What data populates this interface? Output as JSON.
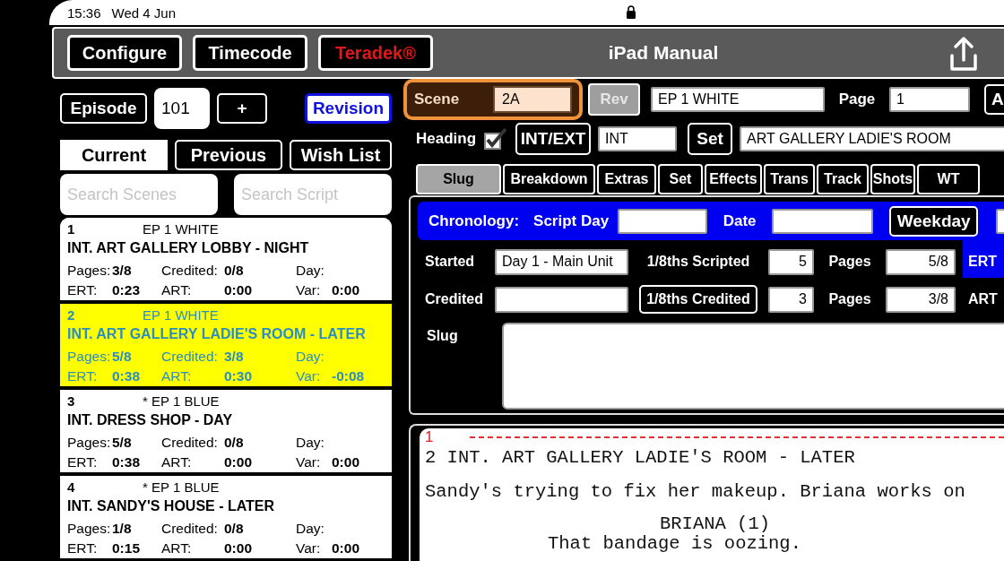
{
  "status_bar": {
    "time": "15:36",
    "date": "Wed 4 Jun"
  },
  "toolbar": {
    "buttons": [
      {
        "label": "Configure",
        "kind": "plain"
      },
      {
        "label": "Timecode",
        "kind": "plain"
      },
      {
        "label": "Teradek®",
        "kind": "alert"
      }
    ],
    "title": "iPad Manual"
  },
  "episode": {
    "button": "Episode",
    "value": "101",
    "add": "+",
    "revision": "Revision"
  },
  "list_tabs": [
    {
      "label": "Current",
      "selected": true
    },
    {
      "label": "Previous",
      "selected": false
    },
    {
      "label": "Wish List",
      "selected": false
    }
  ],
  "search": [
    {
      "placeholder": "Search Scenes"
    },
    {
      "placeholder": "Search Script"
    }
  ],
  "scenes": [
    {
      "number": "1",
      "revision": "EP 1 WHITE",
      "heading": "INT. ART GALLERY LOBBY - NIGHT",
      "selected": false,
      "fields": [
        {
          "label": "Pages:",
          "value": "3/8"
        },
        {
          "label": "Credited:",
          "value": "0/8"
        },
        {
          "label": "Day:"
        },
        {
          "label": "ERT:",
          "value": "0:23"
        },
        {
          "label": "ART:",
          "value": "0:00"
        },
        {
          "label": "Var:",
          "value": "0:00"
        }
      ]
    },
    {
      "number": "2",
      "revision": "EP 1 WHITE",
      "heading": "INT. ART GALLERY LADIE'S ROOM - LATER",
      "selected": true,
      "fields": [
        {
          "label": "Pages:",
          "value": "5/8"
        },
        {
          "label": "Credited:",
          "value": "3/8"
        },
        {
          "label": "Day:"
        },
        {
          "label": "ERT:",
          "value": "0:38"
        },
        {
          "label": "ART:",
          "value": "0:30"
        },
        {
          "label": "Var:",
          "value": "-0:08"
        }
      ]
    },
    {
      "number": "3",
      "revision": "* EP 1 BLUE",
      "heading": "INT. DRESS SHOP - DAY",
      "selected": false,
      "fields": [
        {
          "label": "Pages:",
          "value": "5/8"
        },
        {
          "label": "Credited:",
          "value": "0/8"
        },
        {
          "label": "Day:"
        },
        {
          "label": "ERT:",
          "value": "0:38"
        },
        {
          "label": "ART:",
          "value": "0:00"
        },
        {
          "label": "Var:",
          "value": "0:00"
        }
      ]
    },
    {
      "number": "4",
      "revision": "* EP 1 BLUE",
      "heading": "INT. SANDY'S HOUSE - LATER",
      "selected": false,
      "fields": [
        {
          "label": "Pages:",
          "value": "1/8"
        },
        {
          "label": "Credited:",
          "value": "0/8"
        },
        {
          "label": "Day:"
        },
        {
          "label": "ERT:",
          "value": "0:15"
        },
        {
          "label": "ART:",
          "value": "0:00"
        },
        {
          "label": "Var:",
          "value": "0:00"
        }
      ]
    }
  ],
  "scene": {
    "label": "Scene",
    "value": "2A",
    "rev": {
      "label": "Rev",
      "disabled": true
    },
    "revision_value": "EP 1 WHITE",
    "page_label": "Page",
    "page_value": "1",
    "cut_button": "A"
  },
  "heading": {
    "label": "Heading",
    "checked": true,
    "int_ext_button": "INT/EXT",
    "int_ext_value": "INT",
    "set_button": "Set",
    "set_value": "ART GALLERY LADIE'S ROOM"
  },
  "detail_tabs": [
    {
      "label": "Slug",
      "selected": true
    },
    {
      "label": "Breakdown",
      "selected": false
    },
    {
      "label": "Extras",
      "selected": false
    },
    {
      "label": "Set",
      "selected": false
    },
    {
      "label": "Effects",
      "selected": false
    },
    {
      "label": "Trans",
      "selected": false
    },
    {
      "label": "Track",
      "selected": false
    },
    {
      "label": "Shots",
      "selected": false
    },
    {
      "label": "WT",
      "selected": false
    }
  ],
  "chronology": {
    "label": "Chronology:",
    "script_day_label": "Script Day",
    "date_label": "Date",
    "weekday_button": "Weekday"
  },
  "started_row": {
    "label": "Started",
    "value": "Day 1 - Main Unit",
    "eighths_label": "1/8ths Scripted",
    "eighths_value": "5",
    "pages_label": "Pages",
    "pages_value": "5/8",
    "time_label": "ERT"
  },
  "credited_row": {
    "label": "Credited",
    "eighths_button": "1/8ths Credited",
    "eighths_value": "3",
    "pages_label": "Pages",
    "pages_value": "3/8",
    "time_label": "ART"
  },
  "slug": {
    "label": "Slug"
  },
  "script": {
    "page_number": "1",
    "lines": [
      {
        "kind": "heading",
        "text": "2 INT. ART GALLERY LADIE'S ROOM - LATER"
      },
      {
        "kind": "action",
        "text": "Sandy's trying to fix her makeup. Briana works on"
      },
      {
        "kind": "character",
        "text": "BRIANA  (1)"
      },
      {
        "kind": "dialogue",
        "text": "That bandage is oozing."
      }
    ]
  }
}
